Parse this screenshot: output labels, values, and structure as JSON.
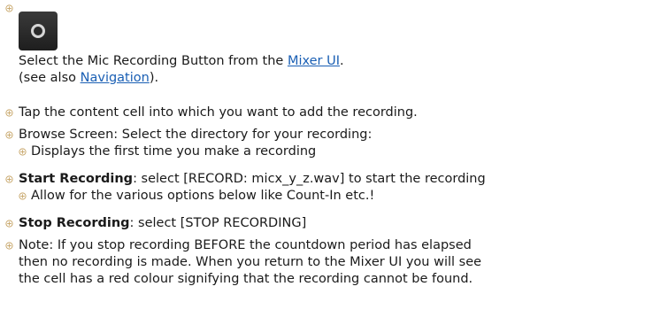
{
  "intro": {
    "select_text": "Select the Mic Recording Button from the ",
    "mixer_ui_link": "Mixer UI",
    "select_text_end": ".",
    "see_also_text": "(see also ",
    "navigation_link": "Navigation",
    "see_also_end": ")."
  },
  "steps": {
    "tap_cell": "Tap the content cell into which you want to add the recording.",
    "browse_screen": "Browse Screen: Select the directory for your recording:",
    "browse_sub": "Displays the first time you make a recording",
    "start_bold": "Start Recording",
    "start_rest": ": select [RECORD: micx_y_z.wav] to start the recording",
    "start_sub": "Allow for the various options below like Count-In etc.!",
    "stop_bold": "Stop Recording",
    "stop_rest": ": select [STOP RECORDING]",
    "note_line1": "Note: If you stop recording BEFORE the countdown period has elapsed",
    "note_line2": "then no recording is made. When you return to the Mixer UI you will see",
    "note_line3": "the cell has a red colour signifying that the recording cannot be found."
  },
  "icons": {
    "bullet": "bullet-icon",
    "record": "mic-record-icon"
  },
  "colors": {
    "link": "#1a5fb4",
    "button_bg": "#2a2a2a",
    "bullet": "#c9a96e"
  }
}
